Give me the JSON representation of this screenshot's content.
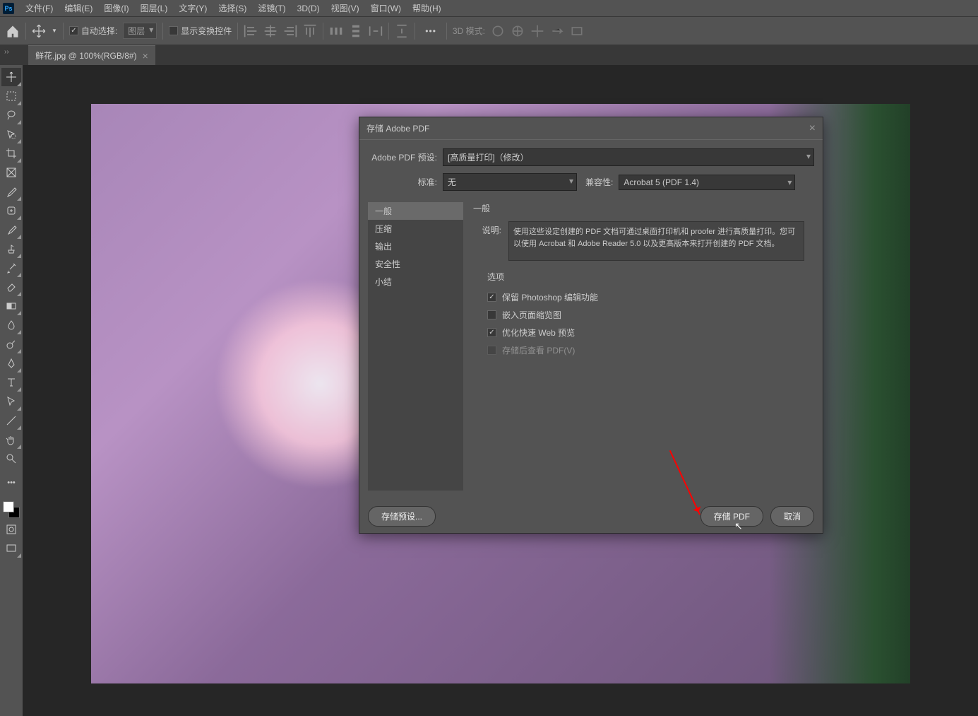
{
  "menubar": {
    "items": [
      "文件(F)",
      "编辑(E)",
      "图像(I)",
      "图层(L)",
      "文字(Y)",
      "选择(S)",
      "滤镜(T)",
      "3D(D)",
      "视图(V)",
      "窗口(W)",
      "帮助(H)"
    ]
  },
  "options": {
    "auto_select": "自动选择:",
    "layer_dd": "图层",
    "transform_controls": "显示变换控件",
    "mode3d_label": "3D 模式:"
  },
  "tab": {
    "title": "鲜花.jpg @ 100%(RGB/8#)"
  },
  "dialog": {
    "title": "存储 Adobe PDF",
    "preset_label": "Adobe PDF 预设:",
    "preset_value": "[高质量打印]（修改）",
    "standard_label": "标准:",
    "standard_value": "无",
    "compat_label": "兼容性:",
    "compat_value": "Acrobat 5 (PDF 1.4)",
    "nav": [
      "一般",
      "压缩",
      "输出",
      "安全性",
      "小结"
    ],
    "section_title": "一般",
    "desc_label": "说明:",
    "desc_text": "使用这些设定创建的 PDF 文档可通过桌面打印机和 proofer 进行高质量打印。您可以使用 Acrobat 和 Adobe Reader 5.0 以及更高版本来打开创建的 PDF 文档。",
    "options_title": "选项",
    "opt1": "保留 Photoshop 编辑功能",
    "opt2": "嵌入页面缩览图",
    "opt3": "优化快速 Web 预览",
    "opt4": "存储后查看 PDF(V)",
    "save_preset": "存储预设...",
    "save_pdf": "存储 PDF",
    "cancel": "取消"
  }
}
